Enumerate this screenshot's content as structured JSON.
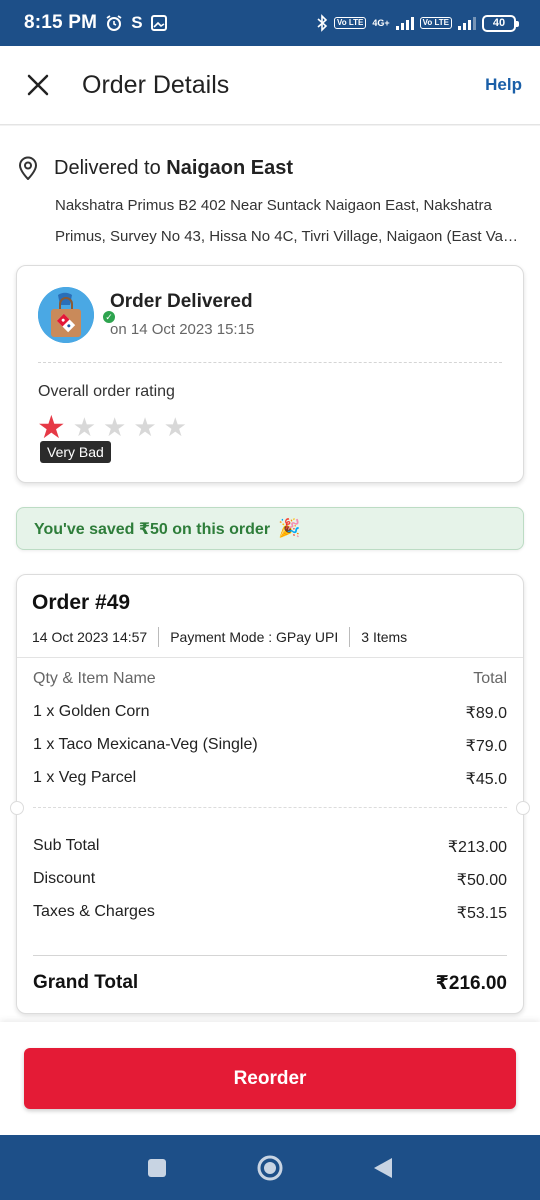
{
  "status_bar": {
    "time": "8:15 PM",
    "sim1": "Vo LTE",
    "sim2": "Vo LTE",
    "network": "4G+",
    "battery": "40"
  },
  "header": {
    "title": "Order Details",
    "help": "Help"
  },
  "address": {
    "prefix": "Delivered to",
    "area": "Naigaon East",
    "line1": "Nakshatra Primus B2 402 Near Suntack Naigaon East, Nakshatra",
    "line2": "Primus, Survey No 43, Hissa No 4C, Tivri Village, Naigaon (East Vas..."
  },
  "delivery": {
    "status": "Order Delivered",
    "date": "on 14 Oct 2023 15:15",
    "rating_label": "Overall order rating",
    "rating_value": 1,
    "rating_max": 5,
    "rating_tooltip": "Very Bad"
  },
  "savings": {
    "text": "You've saved ₹50 on this order"
  },
  "order": {
    "number": "Order #49",
    "datetime": "14 Oct 2023 14:57",
    "payment": "Payment Mode :  GPay UPI",
    "items_count": "3 Items",
    "col_item": "Qty & Item Name",
    "col_total": "Total",
    "items": [
      {
        "name": "1 x Golden Corn",
        "total": "₹89.0"
      },
      {
        "name": "1 x Taco Mexicana-Veg (Single)",
        "total": "₹79.0"
      },
      {
        "name": "1 x Veg Parcel",
        "total": "₹45.0"
      }
    ],
    "summary": [
      {
        "label": "Sub Total",
        "value": "₹213.00"
      },
      {
        "label": "Discount",
        "value": "₹50.00"
      },
      {
        "label": "Taxes & Charges",
        "value": "₹53.15"
      }
    ],
    "grand_total_label": "Grand Total",
    "grand_total_value": "₹216.00"
  },
  "actions": {
    "reorder": "Reorder"
  },
  "colors": {
    "brand_blue": "#1d4f88",
    "accent_red": "#e41b36",
    "success_green": "#2e7d3a",
    "link_blue": "#1a5fa8"
  }
}
